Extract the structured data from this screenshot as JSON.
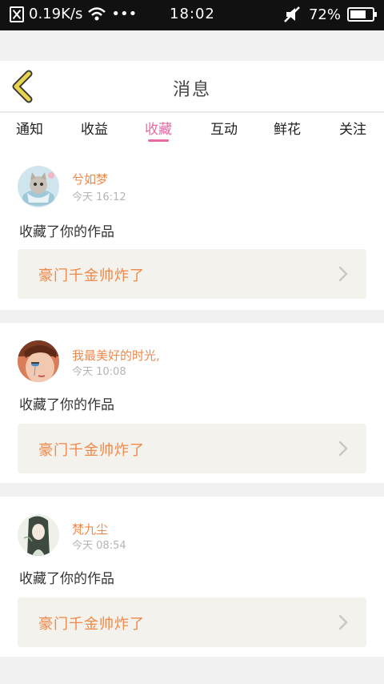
{
  "status_bar": {
    "speed": "0.19K/s",
    "dots": "•••",
    "time": "18:02",
    "battery": "72%",
    "battery_level": 0.72
  },
  "header": {
    "title": "消息",
    "back_icon": "chevron-left-icon",
    "accent": "#e8d44d"
  },
  "tabs": [
    {
      "label": "通知"
    },
    {
      "label": "收益"
    },
    {
      "label": "收藏",
      "active": true
    },
    {
      "label": "互动"
    },
    {
      "label": "鲜花"
    },
    {
      "label": "关注"
    }
  ],
  "colors": {
    "tab_active": "#e76aa2",
    "name": "#f0884a",
    "work_title": "#f0884a",
    "work_box_bg": "#f3f2ec"
  },
  "messages": [
    {
      "user": "兮如梦",
      "time": "今天 16:12",
      "action": "收藏了你的作品",
      "work_title": "豪门千金帅炸了",
      "avatar": "kitten-avatar"
    },
    {
      "user": "我最美好的时光,",
      "time": "今天 10:08",
      "action": "收藏了你的作品",
      "work_title": "豪门千金帅炸了",
      "avatar": "girl-avatar"
    },
    {
      "user": "梵九尘",
      "time": "今天 08:54",
      "action": "收藏了你的作品",
      "work_title": "豪门千金帅炸了",
      "avatar": "ink-portrait-avatar"
    }
  ]
}
